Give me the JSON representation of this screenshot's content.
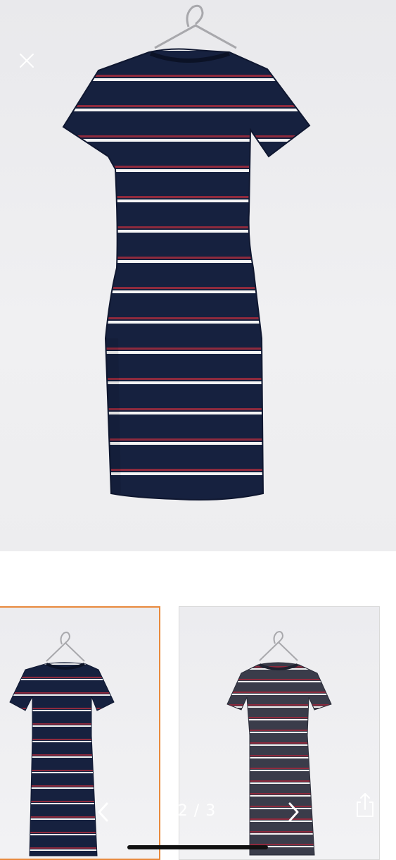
{
  "viewer": {
    "counter": "2 / 3",
    "current_index": 2,
    "total": 3
  },
  "icons": {
    "close": "close-icon",
    "prev": "chevron-left-icon",
    "next": "chevron-right-icon",
    "share": "share-icon"
  },
  "colors": {
    "selected_thumb_border": "#e8893c",
    "dress_navy": "#16213f",
    "dress_grey": "#3a3c4a",
    "stripe_red": "#8e2a3d",
    "stripe_white": "#f4f4f4"
  }
}
